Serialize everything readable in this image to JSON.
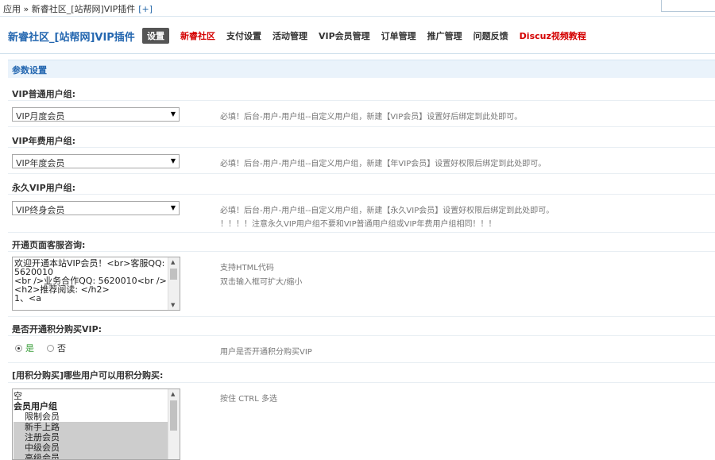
{
  "breadcrumb": {
    "text": "应用 » 新睿社区_[站帮网]VIP插件",
    "plus": "[+]"
  },
  "header": {
    "title": "新睿社区_[站帮网]VIP插件",
    "nav": [
      {
        "label": "设置",
        "style": "active"
      },
      {
        "label": "新睿社区",
        "style": "red"
      },
      {
        "label": "支付设置",
        "style": ""
      },
      {
        "label": "活动管理",
        "style": ""
      },
      {
        "label": "VIP会员管理",
        "style": ""
      },
      {
        "label": "订单管理",
        "style": ""
      },
      {
        "label": "推广管理",
        "style": ""
      },
      {
        "label": "问题反馈",
        "style": ""
      },
      {
        "label": "Discuz视频教程",
        "style": "red"
      }
    ]
  },
  "section": {
    "title": "参数设置"
  },
  "settings": {
    "vip_normal": {
      "label": "VIP普通用户组:",
      "value": "VIP月度会员",
      "hint": "必填！后台-用户-用户组--自定义用户组，新建【VIP会员】设置好后绑定到此处即可。"
    },
    "vip_year": {
      "label": "VIP年费用户组:",
      "value": "VIP年度会员",
      "hint": "必填！后台-用户-用户组--自定义用户组，新建【年VIP会员】设置好权限后绑定到此处即可。"
    },
    "vip_forever": {
      "label": "永久VIP用户组:",
      "value": "VIP终身会员",
      "hint": "必填！后台-用户-用户组--自定义用户组，新建【永久VIP会员】设置好权限后绑定到此处即可。",
      "hint2": "！！！！注意永久VIP用户组不要和VIP普通用户组或VIP年费用户组相同！！！"
    },
    "open_page": {
      "label": "开通页面客服咨询:",
      "content": "欢迎开通本站VIP会员！<br>客服QQ:\n5620010\n<br />业务合作QQ: 5620010<br />\n<h2>推荐阅读: </h2>\n1、<a",
      "hint": "支持HTML代码",
      "hint2": "双击输入框可扩大/缩小"
    },
    "points_buy": {
      "label": "是否开通积分购买VIP:",
      "options": [
        "是",
        "否"
      ],
      "selected": "是",
      "hint": "用户是否开通积分购买VIP"
    },
    "points_groups": {
      "label": "[用积分购买]哪些用户可以用积分购买:",
      "hint": "按住 CTRL 多选",
      "options": [
        {
          "label": "空",
          "type": "plain",
          "selected": false
        },
        {
          "label": "会员用户组",
          "type": "group",
          "selected": false
        },
        {
          "label": "限制会员",
          "type": "item",
          "selected": false
        },
        {
          "label": "新手上路",
          "type": "item",
          "selected": true
        },
        {
          "label": "注册会员",
          "type": "item",
          "selected": true
        },
        {
          "label": "中级会员",
          "type": "item",
          "selected": true
        },
        {
          "label": "高级会员",
          "type": "item",
          "selected": true
        }
      ]
    }
  },
  "colors": {
    "link": "#2467b0",
    "red": "#d40000",
    "section_bg": "#eaf3fb"
  }
}
